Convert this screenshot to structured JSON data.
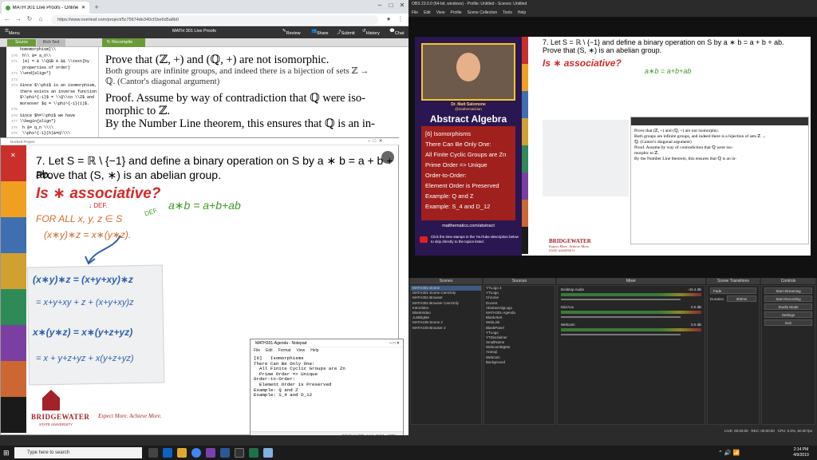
{
  "chrome": {
    "tab_title": "MATH 301 Live Proofs - Online",
    "url": "https://www.overleaf.com/project/5c75674de340cf1be6d5a8b0",
    "overleaf_menu": "Menu",
    "project_name": "MATH 301 Live Proofs",
    "toolbar": {
      "review": "Review",
      "share": "Share",
      "submit": "Submit",
      "history": "History",
      "chat": "Chat"
    },
    "source_tab": "Source",
    "rich_text_tab": "Rich Text",
    "recompile": "Recompile",
    "code_lines": [
      {
        "n": "",
        "t": "homomorphism}\\\\"
      },
      {
        "n": "370",
        "t": "  h\\\\ &= a_n\\\\"
      },
      {
        "n": "371",
        "t": "  (A) = & \\\\QSB A && \\\\text{by"
      },
      {
        "n": "",
        "t": "  properties of order}"
      },
      {
        "n": "372",
        "t": "\\\\end{align*}"
      },
      {
        "n": "373",
        "t": ""
      },
      {
        "n": "374",
        "t": "Since $\\\\phi$ is an isomorphism,"
      },
      {
        "n": "",
        "t": "there exists an inverse function"
      },
      {
        "n": "",
        "t": "$\\\\phi^{-1}$ = \\\\Q\\\\to \\\\Z$ and"
      },
      {
        "n": "",
        "t": "moreover $q = \\\\phi^{-1}(1)$."
      },
      {
        "n": "375",
        "t": ""
      },
      {
        "n": "376",
        "t": "Since $h=\\\\phi$ we have"
      },
      {
        "n": "377",
        "t": "\\\\begin{align*}"
      },
      {
        "n": "378",
        "t": "  h &= q_n \\\\\\\\"
      },
      {
        "n": "379",
        "t": "  \\\\phi^{-1}(h)&=q\\\\\\\\"
      },
      {
        "n": "380",
        "t": "  \\\\phi^{-1}(h,q) &\\\\"
      }
    ],
    "pdf": {
      "line1": "Prove that (ℤ, +) and (ℚ, +) are not isomorphic.",
      "line2": "Both groups are infinite groups, and indeed there is a bijection of sets ℤ →",
      "line3": "ℚ. (Cantor's diagonal argument)",
      "proof1": "Proof.  Assume by way of contradiction that ℚ were iso-",
      "proof2": "morphic to ℤ.",
      "proof3": "By the Number Line theorem, this ensures that ℚ is an in-"
    }
  },
  "overlay": {
    "title": "Docked Project",
    "problem1": "7. Let S = ℝ \\ {−1} and define a binary operation on S by a ∗ b = a + b + ab.",
    "problem2": "Prove that (S, ∗) is an abelian group.",
    "ink_q": "Is ∗ associative?",
    "ink_def1": "↓ DEF.",
    "ink_forall": "FOR ALL x, y, z ∈ S",
    "ink_def2": "DEF.",
    "ink_ab": "a∗b = a+b+ab",
    "ink_lhs": "(x∗y)∗z = x∗(y∗z).",
    "calc1": "(x∗y)∗z = (x+y+xy)∗z",
    "calc2": "= x+y+xy + z + (x+y+xy)z",
    "calc3": "x∗(y∗z) = x∗(y+z+yz)",
    "calc4": "= x + y+z+yz + x(y+z+yz)",
    "logo_name": "BRIDGEWATER",
    "logo_tag": "Expect More. Achieve More.",
    "logo_sub": "STATE UNIVERSITY"
  },
  "notepad": {
    "title": "MATH301-Agenda - Notepad",
    "menu": [
      "File",
      "Edit",
      "Format",
      "View",
      "Help"
    ],
    "text": "[6]   Isomorphisms\nThere Can Be Only One:\n  All Finite Cyclic Groups are Zn\n  Prime Order => Unique\nOrder-to-Order:\n  Element Order is Preserved\nExample: Q and Z\nExample: S_4 and D_12",
    "status_enc": "Windows (CR",
    "status_pos": "Ln 1, Col 1",
    "status_zoom": "100%"
  },
  "obs": {
    "title": "OBS 23.0.0 (64-bit, windows) - Profile: Untitled - Scenes: Untitled",
    "menu": [
      "File",
      "Edit",
      "View",
      "Profile",
      "Scene Collection",
      "Tools",
      "Help"
    ],
    "presenter_name": "Dr. Matt Salomone",
    "presenter_handle": "@mathematician",
    "course": "Abstract Algebra",
    "agenda": [
      "[6]  Isomorphisms",
      "There Can Be Only One:",
      " All Finite Cyclic Groups are Zn",
      " Prime Order => Unique",
      "Order-to-Order:",
      " Element Order is Preserved",
      "Example: Q and Z",
      "Example: S_4 and D_12"
    ],
    "site": "matthematics.com/abstract",
    "yt_note": "Click the time stamps in the YouTube description below to skip directly to the topics listed.",
    "docks": {
      "scenes_title": "Scenes",
      "sources_title": "Sources",
      "mixer_title": "Mixer",
      "transitions_title": "Scene Transitions",
      "controls_title": "Controls",
      "scenes": [
        "MATH301-Scene",
        "MATH301-Scene CamOnly",
        "MATH301-Browser",
        "MATH301-Browser CamOnly",
        "IntroVideo",
        "BlankVideo",
        "JustBigMe",
        "MATH105-Scene 2",
        "MATH105-Browser 2"
      ],
      "sources": [
        "YTLogo 3",
        "YTLogo",
        "Chrome",
        "Docent",
        "AbstractAlgLogo",
        "MATH301-Agenda",
        "BlankAlert",
        "WebLink",
        "BlankPanel",
        "YTLogo",
        "YTDisclaimer",
        "SmallName",
        "WebcamBigMe",
        "Aranoji",
        "Webcam",
        "Background"
      ],
      "mixer": [
        {
          "name": "Desktop Audio",
          "db": "-43.4 dB"
        },
        {
          "name": "Mic/Aux",
          "db": "0.0 dB"
        },
        {
          "name": "Webcam",
          "db": "0.0 dB"
        }
      ],
      "transition": "Fade",
      "duration_label": "Duration",
      "duration": "300ms",
      "controls": [
        "Start Streaming",
        "Start Recording",
        "Studio Mode",
        "Settings",
        "Exit"
      ]
    },
    "status": {
      "live": "LIVE: 00:00:00",
      "rec": "REC: 00:00:00",
      "cpu": "CPU: 0.0%, 60.00 fps"
    }
  },
  "taskbar": {
    "search_placeholder": "Type here to search",
    "time": "2:14 PM",
    "date": "4/9/2019"
  },
  "colors": {
    "olgreen": "#6b9b39",
    "obsbg": "#2b2b2b",
    "purple": "#2a1650",
    "maroon": "#a3222a",
    "colorbar": [
      "#c9302c",
      "#f0a020",
      "#3f6fb0",
      "#d0a030",
      "#2e8b57",
      "#7a3fa0",
      "#cc6633",
      "#1a1a1a"
    ]
  }
}
